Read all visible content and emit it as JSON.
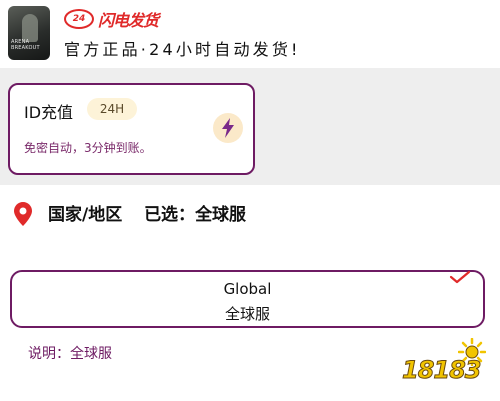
{
  "header": {
    "game_thumbnail_caption": "ARENA BREAKOUT",
    "logo_badge": "24",
    "logo_text": "闪电发货",
    "slogan": "官方正品·24小时自动发货!"
  },
  "recharge": {
    "title": "ID充值",
    "tag": "24H",
    "description": "免密自动，3分钟到账。",
    "icon": "lightning-bolt-icon"
  },
  "region": {
    "icon": "location-pin-icon",
    "label": "国家/地区",
    "selected_prefix": "已选：",
    "selected_value": "全球服"
  },
  "option": {
    "name_en": "Global",
    "name_cn": "全球服",
    "selected": true
  },
  "note": "说明：全球服",
  "watermark": "18183",
  "colors": {
    "accent": "#6e1b63",
    "brand_red": "#e02a2a",
    "tag_bg": "#fdf3d8",
    "watermark": "#f1c400"
  }
}
